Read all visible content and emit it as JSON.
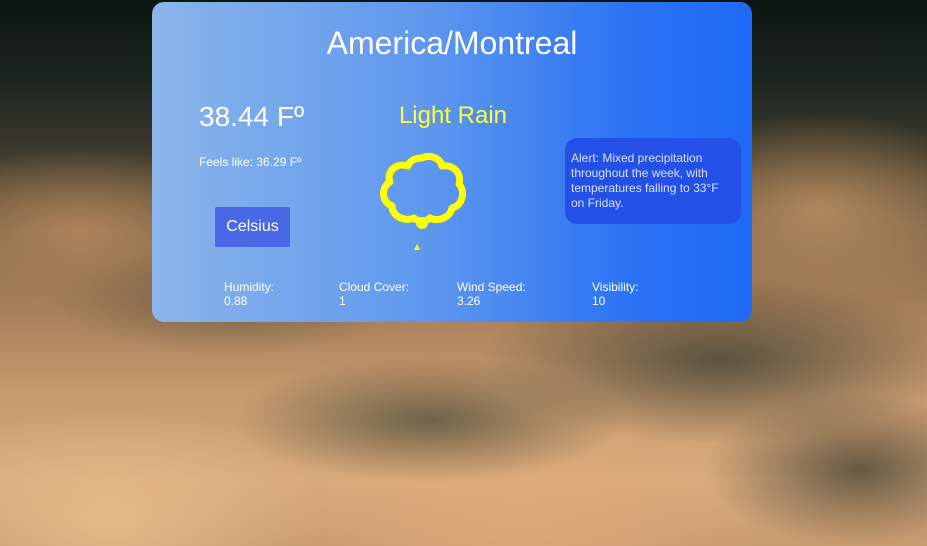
{
  "location": "America/Montreal",
  "temperature": "38.44 Fº",
  "feels_like": "Feels like: 36.29 Fº",
  "unit_toggle_label": "Celsius",
  "condition": "Light Rain",
  "condition_icon": "cloud-icon",
  "alert": "Alert: Mixed precipitation throughout the week, with temperatures falling to 33°F on Friday.",
  "stats": {
    "humidity": {
      "label": "Humidity:",
      "value": "0.88"
    },
    "cloud_cover": {
      "label": "Cloud Cover:",
      "value": "1"
    },
    "wind_speed": {
      "label": "Wind Speed:",
      "value": "3.26"
    },
    "visibility": {
      "label": "Visibility:",
      "value": "10"
    }
  },
  "colors": {
    "card_gradient_start": "#8bb5ea",
    "card_gradient_end": "#1f69f7",
    "condition": "#ffff33",
    "button": "#4a67e6",
    "alert_bg": "#2550e8"
  }
}
